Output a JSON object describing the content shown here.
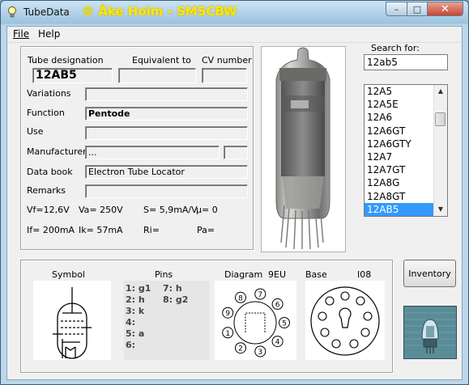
{
  "window": {
    "title": "TubeData",
    "credit": "© Åke Holm - SM5CBW",
    "close_glyph": "✕",
    "min_glyph": "–",
    "max_glyph": "□"
  },
  "menu": {
    "file": "File",
    "help": "Help"
  },
  "labels": {
    "tube_designation": "Tube designation",
    "equivalent_to": "Equivalent to",
    "cv_number": "CV number",
    "variations": "Variations",
    "function": "Function",
    "use": "Use",
    "manufacturer": "Manufacturer",
    "data_book": "Data book",
    "remarks": "Remarks",
    "search_for": "Search for:",
    "symbol": "Symbol",
    "pins": "Pins",
    "diagram": "Diagram",
    "base": "Base"
  },
  "values": {
    "tube_designation": "12AB5",
    "function": "Pentode",
    "manufacturer": "...",
    "data_book": "Electron Tube Locator",
    "search": "12ab5",
    "diagram_code": "9EU",
    "base_code": "I08"
  },
  "specs": {
    "vf": "Vf=12,6V",
    "va": "Va=  250V",
    "s": "S= 5,9mA/V",
    "mu": "µ=     0",
    "if": "If= 200mA",
    "ik": "Ik=    57mA",
    "ri": "Ri=",
    "pa": "Pa="
  },
  "tube_list": [
    "12A5",
    "12A5E",
    "12A6",
    "12A6GT",
    "12A6GTY",
    "12A7",
    "12A7GT",
    "12A8G",
    "12A8GT",
    "12AB5"
  ],
  "selected_tube": "12AB5",
  "pins": {
    "col1": [
      "1: g1",
      "2: h",
      "3: k",
      "4:",
      "5: a",
      "6:"
    ],
    "col2": [
      "7: h",
      "8: g2"
    ]
  },
  "diagram_pins": [
    "1",
    "2",
    "3",
    "4",
    "5",
    "6",
    "7",
    "8",
    "9"
  ],
  "inventory_label": "Inventory",
  "icons": {
    "app": "lightbulb-icon",
    "scroll_up": "▲",
    "scroll_down": "▼"
  },
  "colors": {
    "selection": "#3399ff",
    "credit": "#ffe800",
    "close_button": "#c74532"
  }
}
